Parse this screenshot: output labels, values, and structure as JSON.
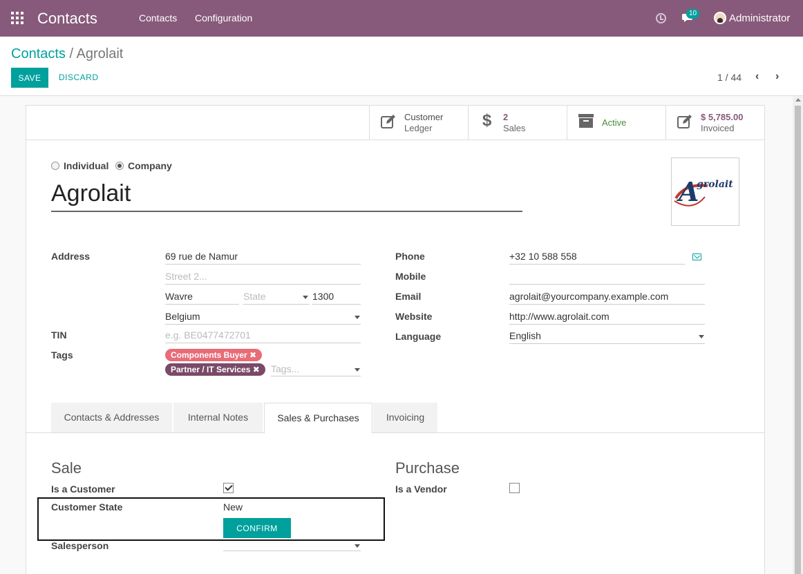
{
  "navbar": {
    "brand": "Contacts",
    "menu": [
      "Contacts",
      "Configuration"
    ],
    "chat_badge": "10",
    "user": "Administrator"
  },
  "breadcrumb": {
    "parent": "Contacts",
    "separator": "/",
    "current": "Agrolait"
  },
  "toolbar": {
    "save": "SAVE",
    "discard": "DISCARD"
  },
  "pager": {
    "value": "1 / 44",
    "prev": "‹",
    "next": "›"
  },
  "stat_buttons": [
    {
      "line1": "Customer",
      "line2": "Ledger",
      "icon": "edit-icon"
    },
    {
      "line1": "2",
      "line2": "Sales",
      "icon": "dollar-icon"
    },
    {
      "line1": "Active",
      "line2": "",
      "icon": "archive-icon"
    },
    {
      "line1": "$ 5,785.00",
      "line2": "Invoiced",
      "icon": "edit-icon"
    }
  ],
  "company_type": {
    "individual": "Individual",
    "company": "Company",
    "selected": "company"
  },
  "partner_name": "Agrolait",
  "logo_text": "grolait",
  "logo_letter": "A",
  "labels": {
    "address": "Address",
    "tin": "TIN",
    "tags": "Tags",
    "phone": "Phone",
    "mobile": "Mobile",
    "email": "Email",
    "website": "Website",
    "language": "Language"
  },
  "address": {
    "street": "69 rue de Namur",
    "street2_placeholder": "Street 2...",
    "city": "Wavre",
    "state_placeholder": "State",
    "zip": "1300",
    "country": "Belgium"
  },
  "tin_placeholder": "e.g. BE0477472701",
  "tags": [
    {
      "label": "Components Buyer",
      "color": "#e86c77"
    },
    {
      "label": "Partner / IT Services",
      "color": "#7a4a68"
    }
  ],
  "tags_placeholder": "Tags...",
  "tag_remove": "✖",
  "contact": {
    "phone": "+32 10 588 558",
    "mobile": "",
    "email": "agrolait@yourcompany.example.com",
    "website": "http://www.agrolait.com",
    "language": "English"
  },
  "tabs": [
    "Contacts & Addresses",
    "Internal Notes",
    "Sales & Purchases",
    "Invoicing"
  ],
  "active_tab": "Sales & Purchases",
  "sale": {
    "title": "Sale",
    "is_customer_label": "Is a Customer",
    "is_customer": true,
    "customer_state_label": "Customer State",
    "customer_state": "New",
    "confirm": "CONFIRM",
    "salesperson_label": "Salesperson",
    "salesperson": ""
  },
  "purchase": {
    "title": "Purchase",
    "is_vendor_label": "Is a Vendor",
    "is_vendor": false
  },
  "colors": {
    "brand": "#875a7b",
    "primary": "#00a09d"
  }
}
